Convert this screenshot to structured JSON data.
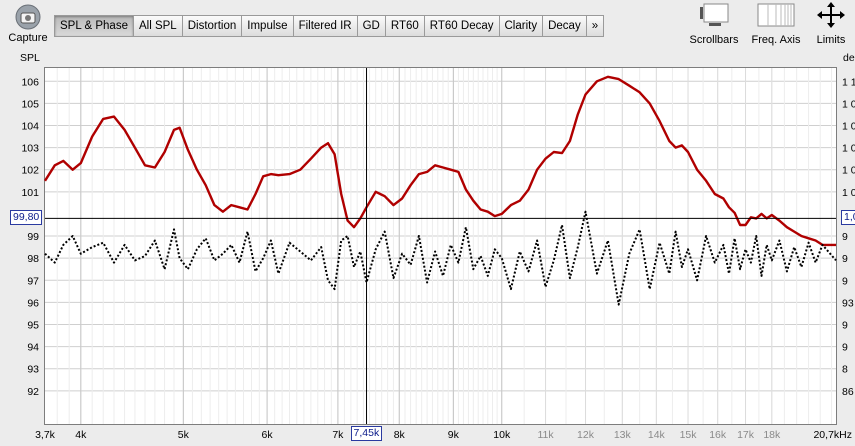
{
  "toolbar": {
    "capture": {
      "label": "Capture",
      "icon": "camera-icon"
    },
    "tabs": [
      {
        "label": "SPL & Phase",
        "active": true
      },
      {
        "label": "All SPL",
        "active": false
      },
      {
        "label": "Distortion",
        "active": false
      },
      {
        "label": "Impulse",
        "active": false
      },
      {
        "label": "Filtered IR",
        "active": false
      },
      {
        "label": "GD",
        "active": false
      },
      {
        "label": "RT60",
        "active": false
      },
      {
        "label": "RT60 Decay",
        "active": false
      },
      {
        "label": "Clarity",
        "active": false
      },
      {
        "label": "Decay",
        "active": false
      },
      {
        "label": "»",
        "active": false
      }
    ],
    "scrollbars": {
      "label": "Scrollbars",
      "icon": "scrollbars-icon"
    },
    "freq_axis": {
      "label": "Freq. Axis",
      "icon": "freq-axis-icon"
    },
    "limits": {
      "label": "Limits",
      "icon": "limits-icon"
    }
  },
  "chart_data": {
    "type": "line",
    "y_left_label": "SPL",
    "y_right_label": "de",
    "ylim": [
      90.5,
      106.6
    ],
    "yticks": [
      {
        "v": 106,
        "label": "106",
        "right": "1 1"
      },
      {
        "v": 105,
        "label": "105",
        "right": "1 0"
      },
      {
        "v": 104,
        "label": "104",
        "right": "1 0"
      },
      {
        "v": 103,
        "label": "103",
        "right": "1 0"
      },
      {
        "v": 102,
        "label": "102",
        "right": "1 0"
      },
      {
        "v": 101,
        "label": "101",
        "right": "1 0"
      },
      {
        "v": 99,
        "label": "99",
        "right": "9"
      },
      {
        "v": 98,
        "label": "98",
        "right": "9"
      },
      {
        "v": 97,
        "label": "97",
        "right": "9"
      },
      {
        "v": 96,
        "label": "96",
        "right": "93"
      },
      {
        "v": 95,
        "label": "95",
        "right": "9"
      },
      {
        "v": 94,
        "label": "94",
        "right": "9"
      },
      {
        "v": 93,
        "label": "93",
        "right": "8"
      },
      {
        "v": 92,
        "label": "92",
        "right": "86"
      }
    ],
    "xlim_hz": [
      3700,
      20700
    ],
    "xaxis_unit": "Hz",
    "xticks": [
      {
        "f": 3700,
        "label": "3,7k",
        "major": true
      },
      {
        "f": 4000,
        "label": "4k",
        "major": true
      },
      {
        "f": 5000,
        "label": "5k",
        "major": true
      },
      {
        "f": 6000,
        "label": "6k",
        "major": true
      },
      {
        "f": 7000,
        "label": "7k",
        "major": true
      },
      {
        "f": 8000,
        "label": "8k",
        "major": true
      },
      {
        "f": 9000,
        "label": "9k",
        "major": true
      },
      {
        "f": 10000,
        "label": "10k",
        "major": true
      },
      {
        "f": 11000,
        "label": "11k",
        "major": false
      },
      {
        "f": 12000,
        "label": "12k",
        "major": false
      },
      {
        "f": 13000,
        "label": "13k",
        "major": false
      },
      {
        "f": 14000,
        "label": "14k",
        "major": false
      },
      {
        "f": 15000,
        "label": "15k",
        "major": false
      },
      {
        "f": 16000,
        "label": "16k",
        "major": false
      },
      {
        "f": 17000,
        "label": "17k",
        "major": false
      },
      {
        "f": 18000,
        "label": "18k",
        "major": false
      },
      {
        "f": 20700,
        "label": "20,7kHz",
        "major": true
      }
    ],
    "cursor": {
      "f": 7450,
      "f_label": "7,45k",
      "spl": 99.8,
      "spl_label": "99,80",
      "right_label": "1,0"
    },
    "series": [
      {
        "color": "#b00000",
        "style": "solid",
        "points": [
          [
            3700,
            101.5
          ],
          [
            3780,
            102.2
          ],
          [
            3850,
            102.4
          ],
          [
            3930,
            102.0
          ],
          [
            4000,
            102.3
          ],
          [
            4100,
            103.5
          ],
          [
            4200,
            104.3
          ],
          [
            4300,
            104.4
          ],
          [
            4400,
            103.8
          ],
          [
            4500,
            103.0
          ],
          [
            4600,
            102.2
          ],
          [
            4700,
            102.1
          ],
          [
            4800,
            102.8
          ],
          [
            4900,
            103.8
          ],
          [
            4960,
            103.9
          ],
          [
            5050,
            102.9
          ],
          [
            5150,
            102.0
          ],
          [
            5250,
            101.3
          ],
          [
            5350,
            100.4
          ],
          [
            5450,
            100.1
          ],
          [
            5550,
            100.4
          ],
          [
            5650,
            100.3
          ],
          [
            5750,
            100.2
          ],
          [
            5850,
            100.9
          ],
          [
            5950,
            101.7
          ],
          [
            6050,
            101.8
          ],
          [
            6150,
            101.75
          ],
          [
            6300,
            101.8
          ],
          [
            6450,
            102.0
          ],
          [
            6600,
            102.5
          ],
          [
            6750,
            103.0
          ],
          [
            6850,
            103.2
          ],
          [
            6950,
            102.7
          ],
          [
            7050,
            100.9
          ],
          [
            7150,
            99.7
          ],
          [
            7250,
            99.4
          ],
          [
            7350,
            99.8
          ],
          [
            7450,
            100.3
          ],
          [
            7600,
            101.0
          ],
          [
            7750,
            100.8
          ],
          [
            7900,
            100.4
          ],
          [
            8050,
            100.7
          ],
          [
            8200,
            101.3
          ],
          [
            8350,
            101.8
          ],
          [
            8500,
            101.9
          ],
          [
            8650,
            102.2
          ],
          [
            8800,
            102.1
          ],
          [
            8950,
            102.0
          ],
          [
            9100,
            101.9
          ],
          [
            9250,
            101.1
          ],
          [
            9400,
            100.6
          ],
          [
            9550,
            100.2
          ],
          [
            9700,
            100.1
          ],
          [
            9850,
            99.9
          ],
          [
            10000,
            100.0
          ],
          [
            10200,
            100.4
          ],
          [
            10400,
            100.6
          ],
          [
            10600,
            101.1
          ],
          [
            10800,
            102.0
          ],
          [
            11000,
            102.5
          ],
          [
            11200,
            102.8
          ],
          [
            11400,
            102.75
          ],
          [
            11600,
            103.3
          ],
          [
            11800,
            104.5
          ],
          [
            12000,
            105.4
          ],
          [
            12300,
            106.0
          ],
          [
            12600,
            106.2
          ],
          [
            12900,
            106.1
          ],
          [
            13200,
            105.8
          ],
          [
            13500,
            105.5
          ],
          [
            13800,
            105.0
          ],
          [
            14100,
            104.2
          ],
          [
            14400,
            103.3
          ],
          [
            14600,
            103.0
          ],
          [
            14800,
            103.1
          ],
          [
            15000,
            102.8
          ],
          [
            15300,
            102.0
          ],
          [
            15600,
            101.5
          ],
          [
            15900,
            100.9
          ],
          [
            16200,
            100.7
          ],
          [
            16400,
            100.3
          ],
          [
            16600,
            100.05
          ],
          [
            16800,
            99.5
          ],
          [
            17000,
            99.5
          ],
          [
            17200,
            99.85
          ],
          [
            17400,
            99.8
          ],
          [
            17600,
            100.0
          ],
          [
            17800,
            99.8
          ],
          [
            18000,
            99.95
          ],
          [
            18300,
            99.7
          ],
          [
            18600,
            99.4
          ],
          [
            18900,
            99.2
          ],
          [
            19200,
            99.0
          ],
          [
            19500,
            98.9
          ],
          [
            19800,
            98.8
          ],
          [
            20100,
            98.6
          ],
          [
            20700,
            98.6
          ]
        ]
      },
      {
        "color": "#000000",
        "style": "dotted",
        "points": [
          [
            3700,
            98.2
          ],
          [
            3780,
            97.8
          ],
          [
            3850,
            98.6
          ],
          [
            3930,
            99.0
          ],
          [
            4000,
            98.2
          ],
          [
            4100,
            98.5
          ],
          [
            4200,
            98.7
          ],
          [
            4300,
            97.8
          ],
          [
            4400,
            98.6
          ],
          [
            4500,
            97.9
          ],
          [
            4600,
            98.1
          ],
          [
            4700,
            98.8
          ],
          [
            4800,
            97.5
          ],
          [
            4900,
            99.3
          ],
          [
            4960,
            98.0
          ],
          [
            5050,
            97.5
          ],
          [
            5150,
            98.4
          ],
          [
            5250,
            98.9
          ],
          [
            5350,
            97.9
          ],
          [
            5450,
            98.2
          ],
          [
            5550,
            98.6
          ],
          [
            5650,
            97.8
          ],
          [
            5750,
            99.2
          ],
          [
            5850,
            97.4
          ],
          [
            5950,
            98.0
          ],
          [
            6050,
            98.8
          ],
          [
            6150,
            97.3
          ],
          [
            6300,
            98.7
          ],
          [
            6450,
            98.3
          ],
          [
            6600,
            97.9
          ],
          [
            6750,
            98.5
          ],
          [
            6850,
            97.0
          ],
          [
            6950,
            96.6
          ],
          [
            7050,
            98.8
          ],
          [
            7150,
            99.0
          ],
          [
            7250,
            97.6
          ],
          [
            7350,
            98.3
          ],
          [
            7450,
            96.9
          ],
          [
            7600,
            98.4
          ],
          [
            7750,
            99.2
          ],
          [
            7900,
            97.1
          ],
          [
            8050,
            98.2
          ],
          [
            8200,
            97.7
          ],
          [
            8350,
            99.0
          ],
          [
            8500,
            96.9
          ],
          [
            8650,
            98.3
          ],
          [
            8800,
            97.2
          ],
          [
            8950,
            98.6
          ],
          [
            9100,
            97.8
          ],
          [
            9250,
            99.4
          ],
          [
            9400,
            97.5
          ],
          [
            9550,
            98.1
          ],
          [
            9700,
            97.2
          ],
          [
            9850,
            98.4
          ],
          [
            10000,
            98.0
          ],
          [
            10200,
            96.6
          ],
          [
            10400,
            98.3
          ],
          [
            10600,
            97.4
          ],
          [
            10800,
            98.8
          ],
          [
            11000,
            96.7
          ],
          [
            11200,
            97.9
          ],
          [
            11400,
            99.5
          ],
          [
            11600,
            97.1
          ],
          [
            11800,
            98.5
          ],
          [
            12000,
            100.1
          ],
          [
            12300,
            97.3
          ],
          [
            12600,
            98.8
          ],
          [
            12900,
            95.9
          ],
          [
            13200,
            98.2
          ],
          [
            13500,
            99.3
          ],
          [
            13800,
            96.6
          ],
          [
            14100,
            98.7
          ],
          [
            14400,
            97.3
          ],
          [
            14600,
            99.2
          ],
          [
            14800,
            97.6
          ],
          [
            15000,
            98.4
          ],
          [
            15300,
            97.0
          ],
          [
            15600,
            99.0
          ],
          [
            15900,
            97.8
          ],
          [
            16200,
            98.6
          ],
          [
            16400,
            97.3
          ],
          [
            16600,
            98.9
          ],
          [
            16800,
            97.5
          ],
          [
            17000,
            98.4
          ],
          [
            17200,
            97.8
          ],
          [
            17400,
            99.0
          ],
          [
            17600,
            97.2
          ],
          [
            17800,
            98.6
          ],
          [
            18000,
            97.9
          ],
          [
            18300,
            98.8
          ],
          [
            18600,
            97.4
          ],
          [
            18900,
            98.5
          ],
          [
            19200,
            97.6
          ],
          [
            19500,
            98.7
          ],
          [
            19800,
            97.8
          ],
          [
            20100,
            98.6
          ],
          [
            20700,
            97.9
          ]
        ]
      }
    ]
  }
}
